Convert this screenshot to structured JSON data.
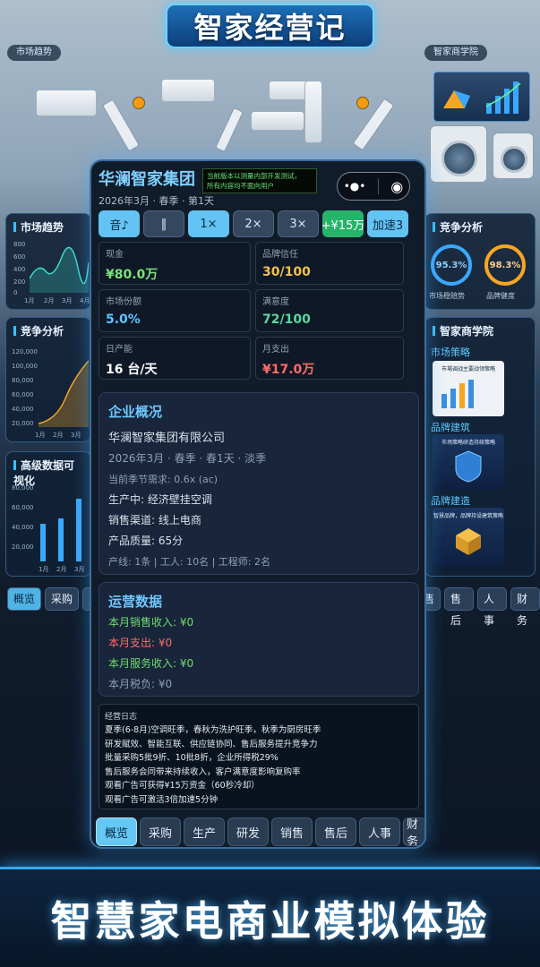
{
  "banner": {
    "title": "智家经营记"
  },
  "scene_labels": {
    "left": "市场趋势",
    "right": "智家商学院"
  },
  "left_panels": {
    "market_trend": {
      "title": "市场趋势",
      "y_ticks": [
        "800",
        "600",
        "400",
        "200",
        "0"
      ],
      "x_ticks": [
        "1月",
        "2月",
        "3月",
        "4月"
      ]
    },
    "competition": {
      "title": "竞争分析",
      "y_ticks": [
        "120,000",
        "100,000",
        "80,000",
        "60,000",
        "40,000",
        "20,000"
      ],
      "x_ticks": [
        "1月",
        "2月",
        "3月"
      ]
    },
    "advanced": {
      "title": "高级数据可视化",
      "y_ticks": [
        "80,000",
        "60,000",
        "40,000",
        "20,000"
      ],
      "x_ticks": [
        "1月",
        "2月",
        "3月"
      ]
    }
  },
  "right_panels": {
    "competition": {
      "title": "竞争分析",
      "gauges": [
        {
          "value": "95.3%",
          "caption": "市场稳赔势",
          "color": "#3aa8ff"
        },
        {
          "value": "98.3%",
          "caption": "品牌健度",
          "color": "#f5a623"
        }
      ]
    },
    "academy": {
      "title": "智家商学院",
      "sections": [
        "市场策略",
        "品牌建筑",
        "品牌建造"
      ],
      "card_captions": [
        "市場调战主要战领策略",
        "市场策略研造持续策略",
        "智慧品牌，品牌持设建筑策略"
      ]
    }
  },
  "background_tabs_left": [
    "概览",
    "采购",
    "生"
  ],
  "background_tabs_right": [
    "售",
    "售后",
    "人事",
    "财务"
  ],
  "phone": {
    "company_title": "华澜智家集团",
    "date_line": "2026年3月 · 春季 · 第1天",
    "ticker": [
      "当前版本以测量内部开发测试，",
      "所有内容均不面向用户"
    ],
    "capsule": {
      "more": "•●•",
      "close": "◉"
    },
    "controls": {
      "sound": "音♪",
      "pause": "‖",
      "speed1": "1×",
      "speed2": "2×",
      "speed3": "3×",
      "bonus": "+¥15万",
      "accelerate": "加速3"
    },
    "stats": [
      {
        "label": "现金",
        "value": "¥80.0万",
        "color": "#7ee07a"
      },
      {
        "label": "品牌信任",
        "value": "30/100",
        "color": "#f2c14e"
      },
      {
        "label": "市场份额",
        "value": "5.0%",
        "color": "#5cc6ff"
      },
      {
        "label": "满意度",
        "value": "72/100",
        "color": "#5cd6a0"
      },
      {
        "label": "日产能",
        "value": "16 台/天",
        "color": "#ffffff"
      },
      {
        "label": "月支出",
        "value": "¥17.0万",
        "color": "#ff6b6b"
      }
    ],
    "overview": {
      "title": "企业概况",
      "company_full": "华澜智家集团有限公司",
      "date_detail": "2026年3月 · 春季 · 春1天 · 淡季",
      "demand": "当前季节需求: 0.6x (ac)",
      "production": "生产中: 经济壁挂空调",
      "channel": "销售渠道: 线上电商",
      "quality": "产品质量: 65分",
      "staff": "产线: 1条 | 工人: 10名 | 工程师: 2名"
    },
    "operations": {
      "title": "运营数据",
      "sales": "本月销售收入: ¥0",
      "expense": "本月支出: ¥0",
      "service": "本月服务收入: ¥0",
      "tax": "本月税负: ¥0"
    },
    "log": {
      "title": "经营日志",
      "lines": [
        "夏季(6-8月)空调旺季，春秋为洗护旺季，秋季为厨房旺季",
        "研发赋效、智能互联、供应链协同、售后服务提升竞争力",
        "批量采购5批9折、10批8折，企业所得税29%",
        "售后服务会同带来持续收入，客户满意度影响复购率",
        "观看广告可获得¥15万资金（60秒冷却）",
        "观看广告可激活3倍加速5分钟"
      ]
    },
    "tabs": [
      "概览",
      "采购",
      "生产",
      "研发",
      "销售",
      "售后",
      "人事",
      "财务"
    ]
  },
  "footer": {
    "tagline": "智慧家电商业模拟体验"
  }
}
